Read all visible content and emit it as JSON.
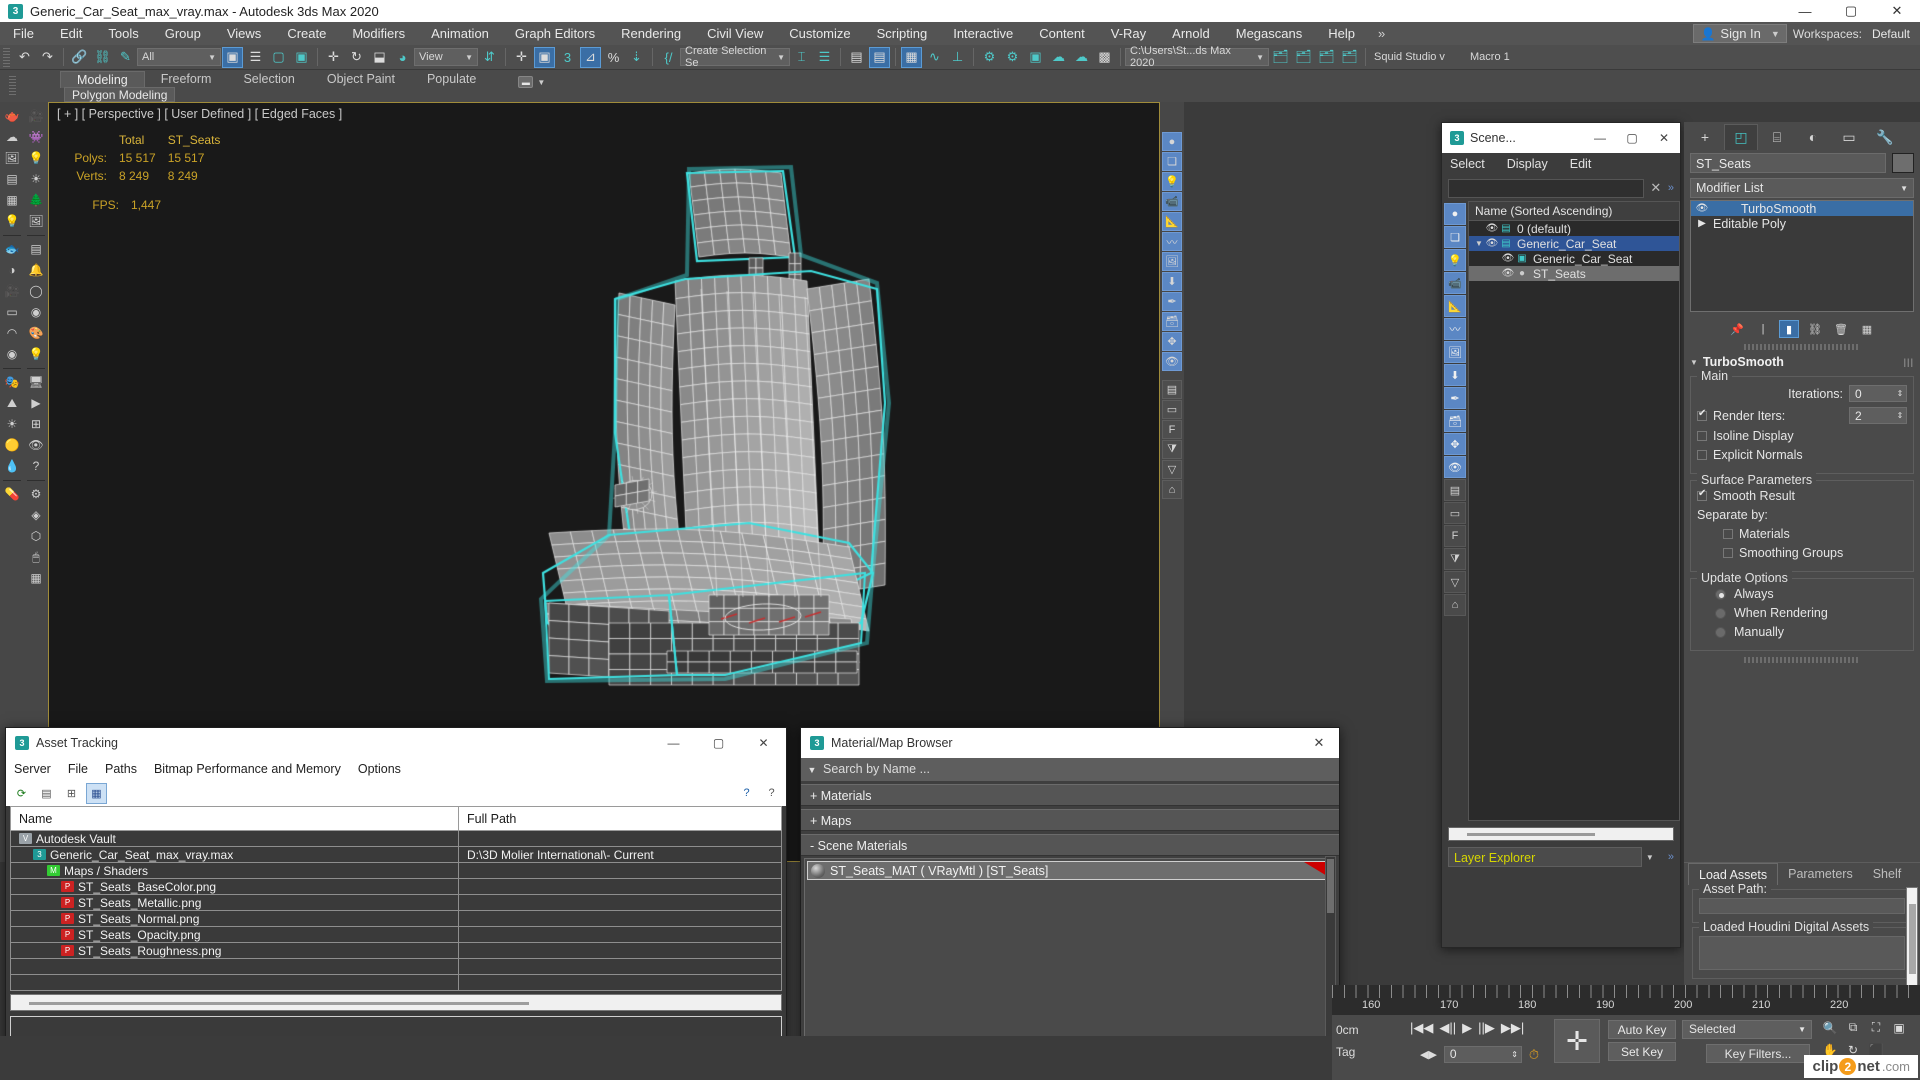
{
  "window": {
    "title": "Generic_Car_Seat_max_vray.max - Autodesk 3ds Max 2020",
    "app_badge": "3",
    "minimize": "—",
    "maximize": "▢",
    "close": "✕"
  },
  "menubar": {
    "items": [
      "File",
      "Edit",
      "Tools",
      "Group",
      "Views",
      "Create",
      "Modifiers",
      "Animation",
      "Graph Editors",
      "Rendering",
      "Civil View",
      "Customize",
      "Scripting",
      "Interactive",
      "Content",
      "V-Ray",
      "Arnold",
      "Megascans",
      "Help"
    ],
    "overflow": "»",
    "signin": "Sign In",
    "workspaces_label": "Workspaces:",
    "workspaces_value": "Default"
  },
  "toolbar": {
    "undo": "↶",
    "redo": "↷",
    "selection_filter": "All",
    "named_selection": "Create Selection Se",
    "ref_coord": "View",
    "project_path": "C:\\Users\\St...ds Max 2020",
    "studio": "Squid Studio v",
    "macro": "Macro 1"
  },
  "ribbon": {
    "tabs": [
      "Modeling",
      "Freeform",
      "Selection",
      "Object Paint",
      "Populate"
    ],
    "selected_tab": "Modeling",
    "sub_tab": "Polygon Modeling"
  },
  "viewport": {
    "label": "[ + ] [ Perspective ] [ User Defined ] [ Edged Faces ]",
    "stats_headers": [
      "",
      "Total",
      "ST_Seats"
    ],
    "stats_rows": [
      {
        "label": "Polys:",
        "total": "15 517",
        "object": "15 517"
      },
      {
        "label": "Verts:",
        "total": "8 249",
        "object": "8 249"
      }
    ],
    "fps_label": "FPS:",
    "fps_value": "1,447",
    "selection_highlight_color": "#3ee0e0"
  },
  "scene_explorer": {
    "title": "Scene...",
    "menu": [
      "Select",
      "Display",
      "Edit"
    ],
    "search_value": "",
    "clear_icon": "✕",
    "overflow": "»",
    "column_header": "Name (Sorted Ascending)",
    "rows": [
      {
        "name": "0 (default)",
        "indent": 1,
        "type": "layer",
        "selected": false,
        "expander": ""
      },
      {
        "name": "Generic_Car_Seat",
        "indent": 1,
        "type": "layer",
        "selected": true,
        "expander": "▼"
      },
      {
        "name": "Generic_Car_Seat",
        "indent": 2,
        "type": "group",
        "selected": false,
        "expander": ""
      },
      {
        "name": "ST_Seats",
        "indent": 2,
        "type": "object",
        "selected": false,
        "highlight": true,
        "expander": ""
      }
    ],
    "layer_dropdown": "Layer Explorer"
  },
  "command_panel": {
    "tabs": [
      "create",
      "modify",
      "hierarchy",
      "motion",
      "display",
      "utilities"
    ],
    "selected_tab": "modify",
    "object_name": "ST_Seats",
    "modifier_list_label": "Modifier List",
    "stack": [
      {
        "name": "TurboSmooth",
        "selected": true,
        "eye": "👁"
      },
      {
        "name": "Editable Poly",
        "selected": false,
        "eye": "▶"
      }
    ],
    "rollout_title": "TurboSmooth",
    "groups": {
      "main": {
        "label": "Main",
        "iterations_label": "Iterations:",
        "iterations_value": "0",
        "render_iters_label": "Render Iters:",
        "render_iters_value": "2",
        "render_iters_checked": true,
        "isoline_display": "Isoline Display",
        "isoline_checked": false,
        "explicit_normals": "Explicit Normals",
        "explicit_checked": false
      },
      "surface": {
        "label": "Surface Parameters",
        "smooth_result": "Smooth Result",
        "smooth_checked": true,
        "separate_by": "Separate by:",
        "materials": "Materials",
        "materials_checked": false,
        "smoothing_groups": "Smoothing Groups",
        "smoothing_checked": false
      },
      "update": {
        "label": "Update Options",
        "options": [
          "Always",
          "When Rendering",
          "Manually"
        ],
        "selected": "Always"
      }
    }
  },
  "houdini_panel": {
    "tabs": [
      "Load Assets",
      "Parameters",
      "Shelf"
    ],
    "selected_tab": "Load Assets",
    "asset_path_label": "Asset Path:",
    "asset_path_value": "",
    "loaded_label": "Loaded Houdini Digital Assets"
  },
  "asset_tracking": {
    "title": "Asset Tracking",
    "menu": [
      "Server",
      "File",
      "Paths",
      "Bitmap Performance and Memory",
      "Options"
    ],
    "columns": [
      "Name",
      "Full Path"
    ],
    "rows": [
      {
        "name": "Autodesk Vault",
        "path": "",
        "indent": 1,
        "icon": "vault",
        "icon_color": "#9aa2a8"
      },
      {
        "name": "Generic_Car_Seat_max_vray.max",
        "path": "D:\\3D Molier International\\- Current",
        "indent": 2,
        "icon": "max",
        "icon_color": "#1f9a96"
      },
      {
        "name": "Maps / Shaders",
        "path": "",
        "indent": 3,
        "icon": "maps",
        "icon_color": "#33cc33"
      },
      {
        "name": "ST_Seats_BaseColor.png",
        "path": "",
        "indent": 4,
        "icon": "png",
        "icon_color": "#cc2222"
      },
      {
        "name": "ST_Seats_Metallic.png",
        "path": "",
        "indent": 4,
        "icon": "png",
        "icon_color": "#cc2222"
      },
      {
        "name": "ST_Seats_Normal.png",
        "path": "",
        "indent": 4,
        "icon": "png",
        "icon_color": "#cc2222"
      },
      {
        "name": "ST_Seats_Opacity.png",
        "path": "",
        "indent": 4,
        "icon": "png",
        "icon_color": "#cc2222"
      },
      {
        "name": "ST_Seats_Roughness.png",
        "path": "",
        "indent": 4,
        "icon": "png",
        "icon_color": "#cc2222"
      },
      {
        "name": "",
        "path": "",
        "indent": 1,
        "icon": "",
        "icon_color": ""
      },
      {
        "name": "",
        "path": "",
        "indent": 1,
        "icon": "",
        "icon_color": ""
      }
    ]
  },
  "material_browser": {
    "title": "Material/Map Browser",
    "search_placeholder": "Search by Name ...",
    "sections": [
      {
        "label": "+ Materials"
      },
      {
        "label": "+ Maps"
      },
      {
        "label": "- Scene Materials"
      }
    ],
    "scene_materials": [
      {
        "name": "ST_Seats_MAT  ( VRayMtl )  [ST_Seats]",
        "flag_color": "#cc0000"
      }
    ]
  },
  "timebar": {
    "ticks": [
      "160",
      "170",
      "180",
      "190",
      "200",
      "210",
      "220"
    ]
  },
  "statusbar": {
    "unit_readout": "0cm",
    "tag_label": "Tag",
    "frame_value": "0",
    "auto_key": "Auto Key",
    "set_key": "Set Key",
    "key_mode": "Selected",
    "key_filters": "Key Filters...",
    "transport": [
      "|◀◀",
      "◀||",
      "▶",
      "||▶",
      "▶▶|"
    ]
  },
  "watermark": {
    "prefix": "clip",
    "circle": "2",
    "suffix": "net",
    "domain": ".com"
  }
}
